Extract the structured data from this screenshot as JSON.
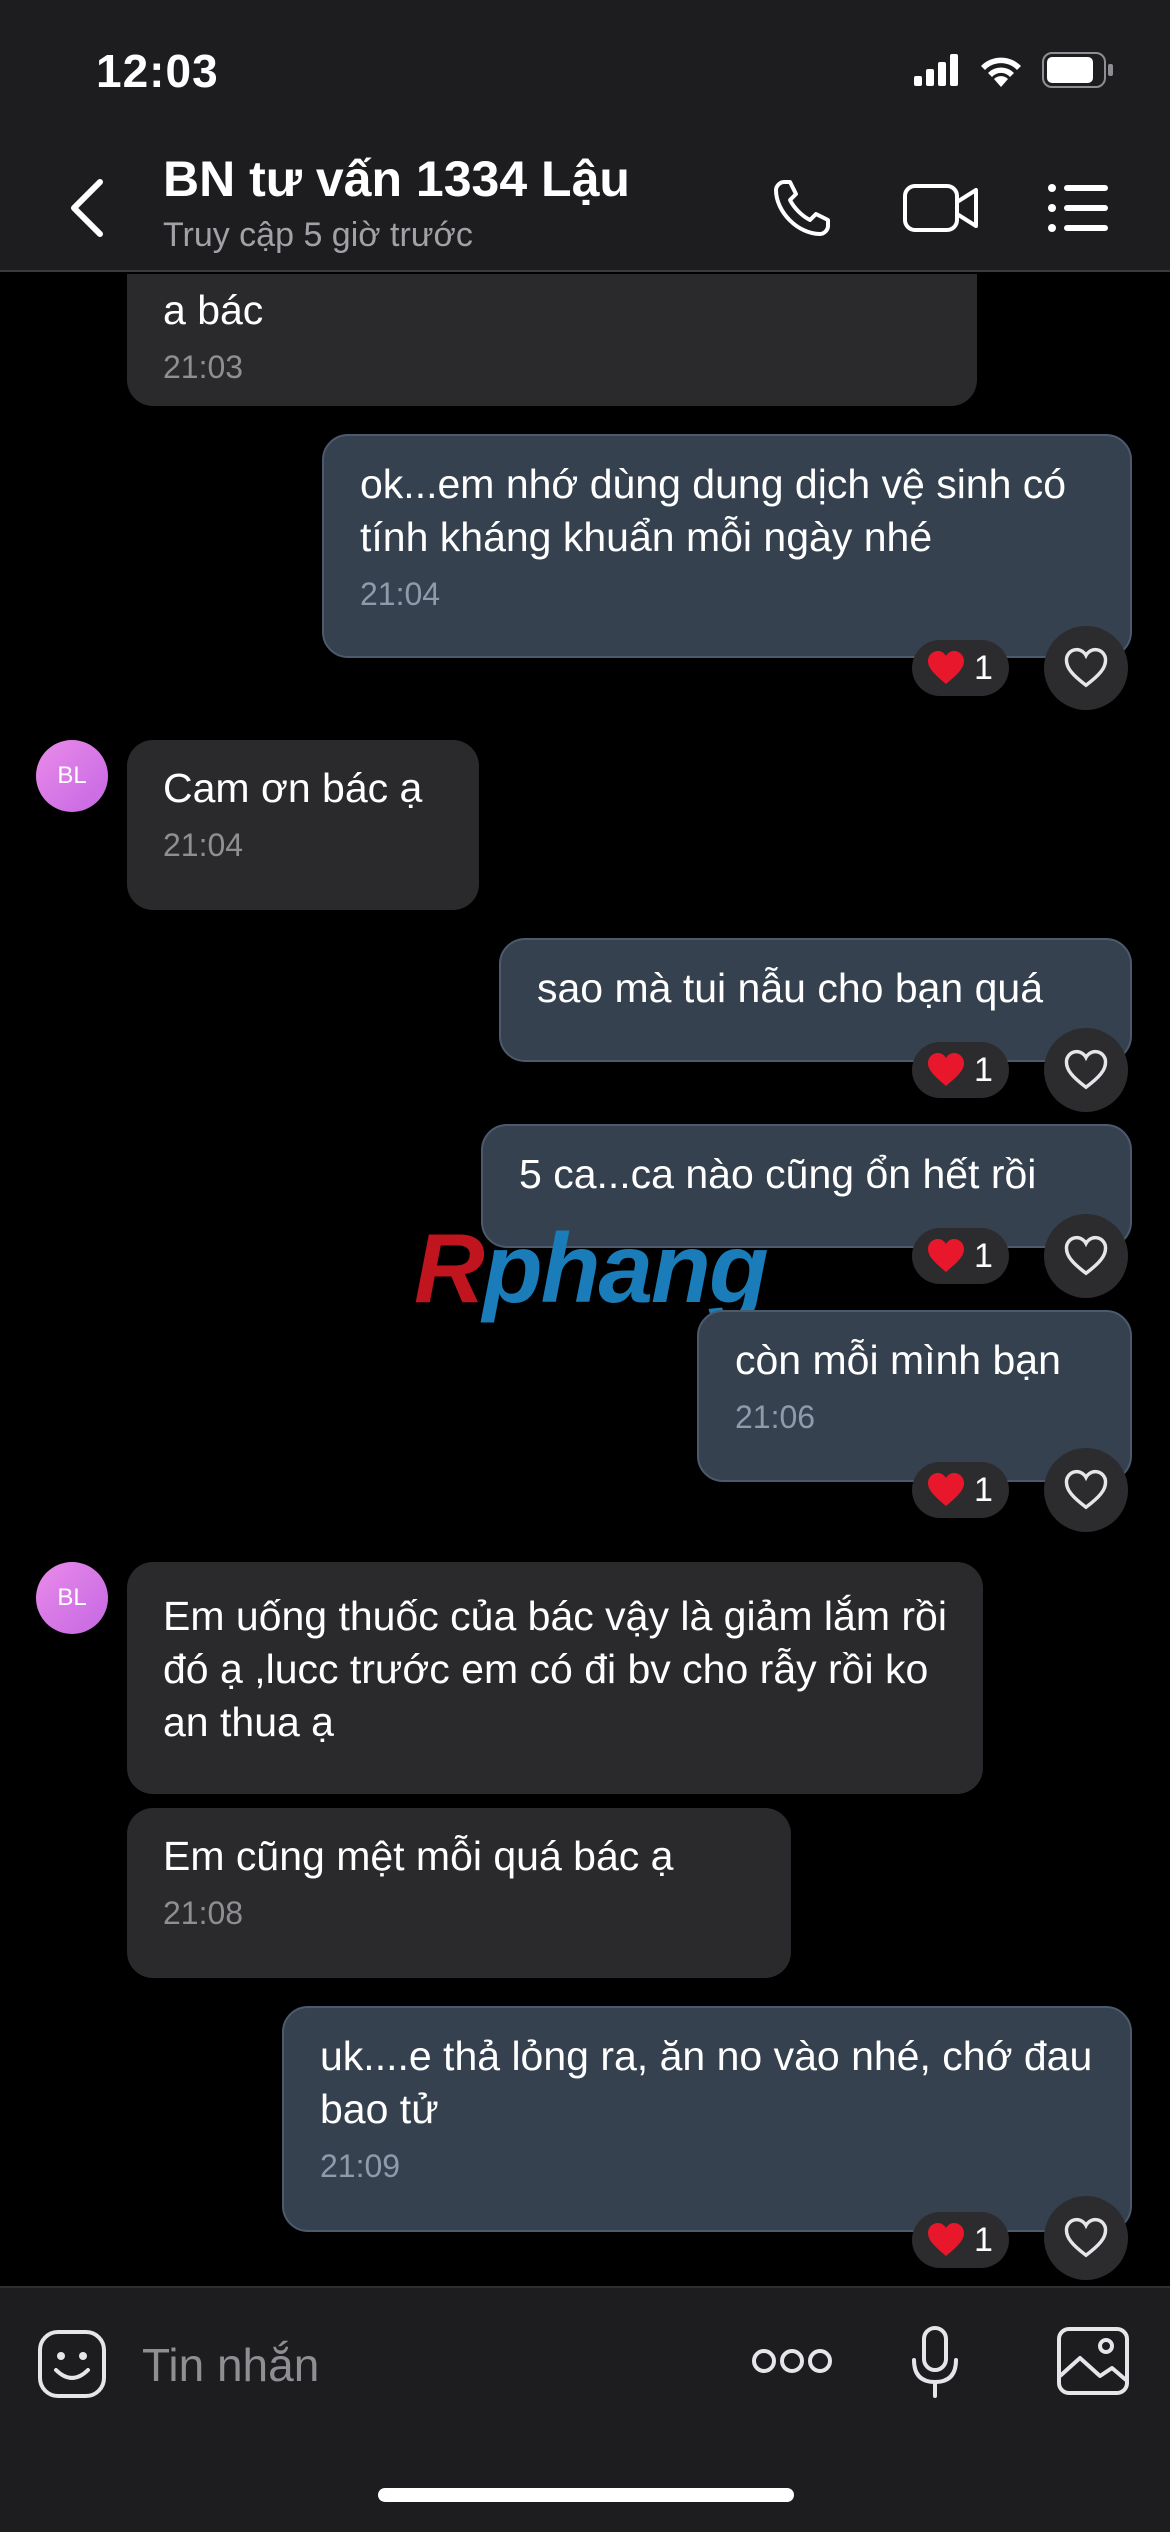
{
  "status": {
    "time": "12:03"
  },
  "header": {
    "title": "BN tư vấn 1334 Lậu",
    "subtitle": "Truy cập 5 giờ trước"
  },
  "avatar_initials": "BL",
  "watermark": {
    "first": "R",
    "rest": "phang"
  },
  "messages": [
    {
      "dir": "in",
      "text": "a bác",
      "time": "21:03"
    },
    {
      "dir": "out",
      "text": "ok...em nhớ dùng dung dịch vệ sinh có tính kháng khuẩn mỗi ngày nhé",
      "time": "21:04",
      "reaction": "1"
    },
    {
      "dir": "in",
      "text": "Cam ơn bác ạ",
      "time": "21:04"
    },
    {
      "dir": "out",
      "text": "sao mà tui nẫu cho bạn quá",
      "reaction": "1"
    },
    {
      "dir": "out",
      "text": "5 ca...ca nào cũng ổn hết rồi",
      "reaction": "1"
    },
    {
      "dir": "out",
      "text": "còn mỗi mình bạn",
      "time": "21:06",
      "reaction": "1"
    },
    {
      "dir": "in",
      "text": "Em uống  thuốc của  bác  vậy là  giảm lắm  rồi  đó  ạ  ,lucc trước  em có  đi bv cho rẫy  rồi  ko an thua  ạ"
    },
    {
      "dir": "in",
      "text": "Em cũng mệt mỗi  quá  bác ạ",
      "time": "21:08"
    },
    {
      "dir": "out",
      "text": "uk....e thả lỏng ra, ăn no vào nhé, chớ đau bao tử",
      "time": "21:09",
      "reaction": "1"
    }
  ],
  "input": {
    "placeholder": "Tin nhắn"
  }
}
